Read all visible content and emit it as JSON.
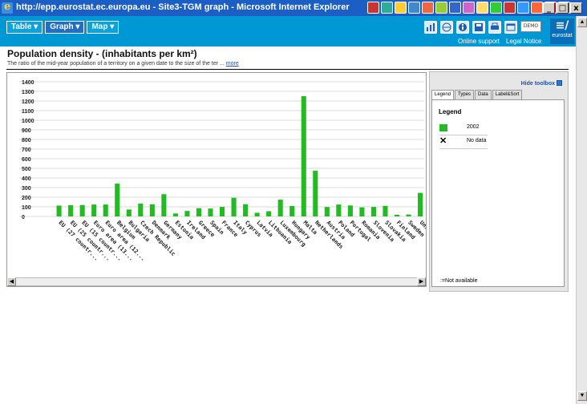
{
  "window": {
    "title": "http://epp.eurostat.ec.europa.eu - Site3-TGM graph - Microsoft Internet Explorer",
    "controls": [
      "_",
      "□",
      "x"
    ]
  },
  "toolbar": {
    "tabs": [
      {
        "label": "Table ▾",
        "active": false
      },
      {
        "label": "Graph ▾",
        "active": true
      },
      {
        "label": "Map ▾",
        "active": false
      }
    ],
    "icons": [
      "chart-icon",
      "globe-icon",
      "info-icon",
      "save-icon",
      "print-icon",
      "window-icon"
    ],
    "demo_label": "DEMO",
    "links": [
      "Online support",
      "Legal Notice"
    ],
    "logo_text": "eurostat"
  },
  "page": {
    "title": "Population density - (inhabitants per km²)",
    "subtitle": "The ratio of the mid-year population of a territory on a given date to the size of the ter ...",
    "more_link": "more"
  },
  "chart_data": {
    "type": "bar",
    "ylim": [
      0,
      1400
    ],
    "yticks": [
      "0",
      "100",
      "200",
      "300",
      "400",
      "500",
      "600",
      "700",
      "800",
      "900",
      "1000",
      "1100",
      "1200",
      "1300",
      "1400"
    ],
    "categories": [
      "EU (27 countr...",
      "EU (25 countr...",
      "EU (15 countr...",
      "Euro area (13...",
      "Euro area (12...",
      "Belgium",
      "Bulgaria",
      "Czech Republic",
      "Denmark",
      "Germany",
      "Estonia",
      "Ireland",
      "Greece",
      "Spain",
      "France",
      "Italy",
      "Cyprus",
      "Latvia",
      "Lithuania",
      "Luxembourg",
      "Hungary",
      "Malta",
      "Netherlands",
      "Austria",
      "Poland",
      "Portugal",
      "Romania",
      "Slovenia",
      "Slovakia",
      "Finland",
      "Sweden",
      "United"
    ],
    "series": [
      {
        "name": "2002",
        "color": "#22bb22",
        "values": [
          113,
          117,
          119,
          124,
          124,
          341,
          72,
          133,
          126,
          231,
          31,
          57,
          86,
          82,
          99,
          194,
          127,
          38,
          54,
          174,
          109,
          1250,
          475,
          98,
          124,
          114,
          94,
          99,
          110,
          17,
          20,
          245
        ]
      }
    ]
  },
  "toolbox": {
    "hide_label": "Hide toolbox",
    "tabs": [
      "Legend",
      "Types",
      "Data",
      "Label&Sort"
    ],
    "active_tab": "Legend",
    "legend_title": "Legend",
    "entries": [
      {
        "label": "2002",
        "color": "#22bb22"
      },
      {
        "label": "No data",
        "symbol": "✕"
      }
    ],
    "not_available": ":=Not available"
  }
}
